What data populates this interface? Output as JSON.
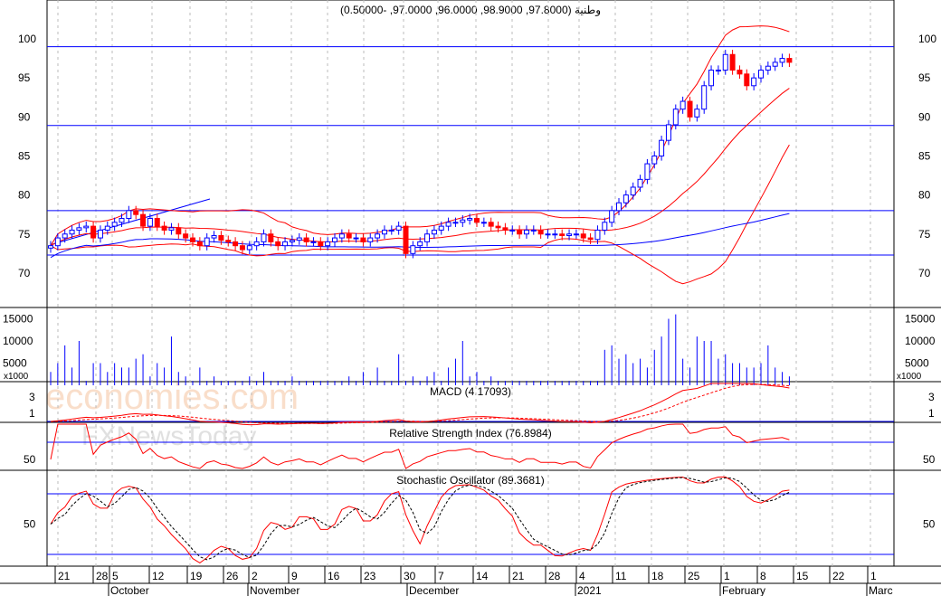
{
  "title": "وطنية (97.8000, 98.9000, 96.0000, 97.0000, -0.50000)",
  "watermark": [
    "economies.com",
    "FXNewsToday"
  ],
  "panels": {
    "macd": "MACD (4.17093)",
    "rsi": "Relative Strength Index (76.8984)",
    "stoch": "Stochastic Oscillator (89.3681)"
  },
  "volume_unit": "x1000",
  "colors": {
    "up": "#0000ff",
    "down": "#ff0000",
    "band": "#ff0000",
    "ma": "#0000ff",
    "line": "#0000ff"
  },
  "chart_data": {
    "type": "candlestick",
    "price_ticks": [
      100,
      95,
      90,
      85,
      80,
      75,
      70
    ],
    "volume_ticks": [
      15000,
      10000,
      5000
    ],
    "macd_ticks": [
      3,
      1
    ],
    "rsi_ticks": [
      50
    ],
    "stoch_ticks": [
      50
    ],
    "x_ticks": [
      "21",
      "28",
      "5",
      "12",
      "19",
      "26",
      "2",
      "9",
      "16",
      "23",
      "30",
      "7",
      "14",
      "21",
      "28",
      "4",
      "11",
      "18",
      "25",
      "1",
      "8",
      "15",
      "22",
      "1"
    ],
    "months": [
      "October",
      "November",
      "December",
      "2021",
      "February",
      "Marc"
    ],
    "support_resistance": [
      99,
      88.9,
      78,
      72.3
    ],
    "close": [
      73.5,
      74.5,
      75,
      75.5,
      75.8,
      76,
      74.5,
      75.5,
      76,
      76.5,
      77,
      78,
      77.5,
      76,
      77,
      76,
      75.5,
      75.8,
      75,
      74.5,
      74,
      73.5,
      74.5,
      74.8,
      74.2,
      74,
      73.5,
      73,
      73.5,
      74,
      75,
      74,
      73.5,
      74,
      74.2,
      74.5,
      74,
      74,
      73.5,
      74,
      74.5,
      75,
      74.5,
      74.5,
      74,
      74.5,
      75,
      75.5,
      75.5,
      76,
      72.5,
      73.5,
      74,
      75,
      75.5,
      76,
      76.5,
      76.5,
      76.8,
      77,
      76.5,
      76.5,
      76,
      75.8,
      75.5,
      75.5,
      75,
      75.5,
      75.5,
      75,
      75,
      75,
      74.8,
      75,
      75,
      74.5,
      74.3,
      75.5,
      76.5,
      78,
      79,
      80,
      81,
      82,
      84,
      85,
      87,
      89,
      91,
      92,
      90,
      91,
      94,
      96,
      96,
      98,
      96,
      95.5,
      94,
      95,
      96,
      96.5,
      97,
      97.5,
      97
    ],
    "volume_k": [
      3,
      5,
      9,
      4,
      10,
      1,
      5,
      5,
      3,
      5,
      4,
      4,
      6,
      7,
      2,
      5,
      4,
      11,
      3,
      2,
      1,
      4,
      1,
      2,
      1,
      1,
      1,
      1,
      2,
      1,
      3,
      1,
      1,
      1,
      2,
      1,
      1,
      1,
      1,
      1,
      1,
      1,
      2,
      1,
      3,
      1,
      4,
      1,
      1,
      7,
      1,
      2,
      1,
      2,
      3,
      1,
      4,
      6,
      10,
      2,
      3,
      1,
      2,
      1,
      1,
      1,
      1,
      1,
      1,
      1,
      1,
      1,
      1,
      1,
      1,
      1,
      1,
      1,
      8,
      9,
      6,
      7,
      5,
      6,
      4,
      8,
      11,
      15,
      16,
      6,
      4,
      11,
      10,
      10,
      6,
      7,
      5,
      5,
      4,
      4,
      5,
      9,
      4,
      3,
      2
    ]
  }
}
